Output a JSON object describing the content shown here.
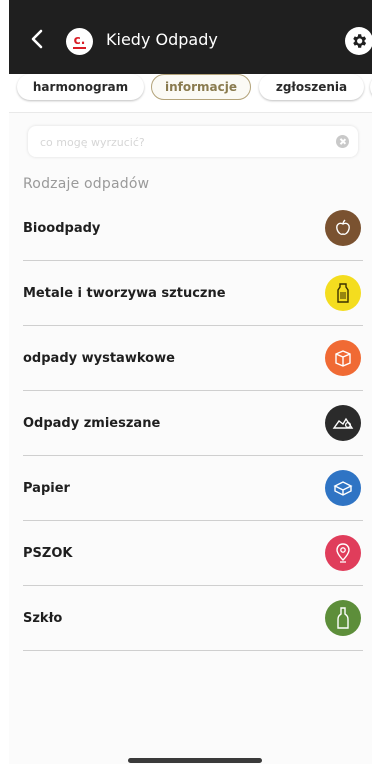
{
  "header": {
    "title": "Kiedy Odpady",
    "logo_text": "c."
  },
  "tabs": [
    {
      "label": "harmonogram"
    },
    {
      "label": "informacje",
      "active": true
    },
    {
      "label": "zgłoszenia"
    }
  ],
  "search": {
    "placeholder": "co mogę wyrzucić?"
  },
  "section_title": "Rodzaje odpadów",
  "waste_types": [
    {
      "label": "Bioodpady",
      "color": "#7a5230",
      "icon": "apple-icon"
    },
    {
      "label": "Metale i tworzywa sztuczne",
      "color": "#f4dd1f",
      "icon": "bottle-icon"
    },
    {
      "label": "odpady wystawkowe",
      "color": "#f06a34",
      "icon": "box-icon"
    },
    {
      "label": "Odpady zmieszane",
      "color": "#2b2b2b",
      "icon": "trash-pile-icon"
    },
    {
      "label": "Papier",
      "color": "#2f74c4",
      "icon": "package-icon"
    },
    {
      "label": "PSZOK",
      "color": "#e03d5b",
      "icon": "location-pin-icon"
    },
    {
      "label": "Szkło",
      "color": "#5d8e3a",
      "icon": "glass-bottle-icon"
    }
  ]
}
